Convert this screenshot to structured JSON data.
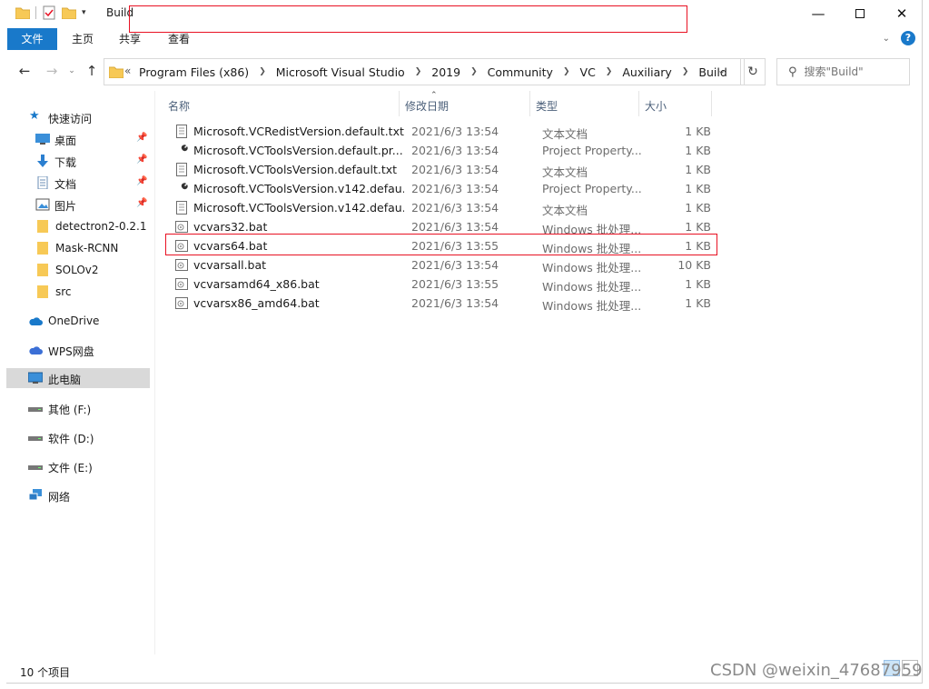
{
  "window": {
    "title": "Build"
  },
  "ribbon": {
    "tabs": [
      "文件",
      "主页",
      "共享",
      "查看"
    ]
  },
  "address": {
    "overflow": "«",
    "crumbs": [
      "Program Files (x86)",
      "Microsoft Visual Studio",
      "2019",
      "Community",
      "VC",
      "Auxiliary",
      "Build"
    ]
  },
  "search": {
    "placeholder": "搜索\"Build\""
  },
  "nav": {
    "quick_access": "快速访问",
    "pinned": [
      "桌面",
      "下载",
      "文档",
      "图片"
    ],
    "folders": [
      "detectron2-0.2.1",
      "Mask-RCNN",
      "SOLOv2",
      "src"
    ],
    "onedrive": "OneDrive",
    "wps": "WPS网盘",
    "this_pc": "此电脑",
    "drives": [
      "其他 (F:)",
      "软件 (D:)",
      "文件 (E:)"
    ],
    "network": "网络"
  },
  "columns": {
    "name": "名称",
    "date": "修改日期",
    "type": "类型",
    "size": "大小"
  },
  "files": [
    {
      "name": "Microsoft.VCRedistVersion.default.txt",
      "date": "2021/6/3 13:54",
      "type": "文本文档",
      "size": "1 KB",
      "icon": "text-file-icon"
    },
    {
      "name": "Microsoft.VCToolsVersion.default.pr...",
      "date": "2021/6/3 13:54",
      "type": "Project Property...",
      "size": "1 KB",
      "icon": "wrench-icon"
    },
    {
      "name": "Microsoft.VCToolsVersion.default.txt",
      "date": "2021/6/3 13:54",
      "type": "文本文档",
      "size": "1 KB",
      "icon": "text-file-icon"
    },
    {
      "name": "Microsoft.VCToolsVersion.v142.defau...",
      "date": "2021/6/3 13:54",
      "type": "Project Property...",
      "size": "1 KB",
      "icon": "wrench-icon"
    },
    {
      "name": "Microsoft.VCToolsVersion.v142.defau...",
      "date": "2021/6/3 13:54",
      "type": "文本文档",
      "size": "1 KB",
      "icon": "text-file-icon"
    },
    {
      "name": "vcvars32.bat",
      "date": "2021/6/3 13:54",
      "type": "Windows 批处理...",
      "size": "1 KB",
      "icon": "batch-file-icon"
    },
    {
      "name": "vcvars64.bat",
      "date": "2021/6/3 13:55",
      "type": "Windows 批处理...",
      "size": "1 KB",
      "icon": "batch-file-icon"
    },
    {
      "name": "vcvarsall.bat",
      "date": "2021/6/3 13:54",
      "type": "Windows 批处理...",
      "size": "10 KB",
      "icon": "batch-file-icon"
    },
    {
      "name": "vcvarsamd64_x86.bat",
      "date": "2021/6/3 13:55",
      "type": "Windows 批处理...",
      "size": "1 KB",
      "icon": "batch-file-icon"
    },
    {
      "name": "vcvarsx86_amd64.bat",
      "date": "2021/6/3 13:54",
      "type": "Windows 批处理...",
      "size": "1 KB",
      "icon": "batch-file-icon"
    }
  ],
  "status": {
    "count": "10 个项目"
  },
  "watermark": "CSDN @weixin_47687959",
  "colors": {
    "accent": "#1979ca",
    "highlight": "#e81123",
    "folder": "#f7c956"
  }
}
